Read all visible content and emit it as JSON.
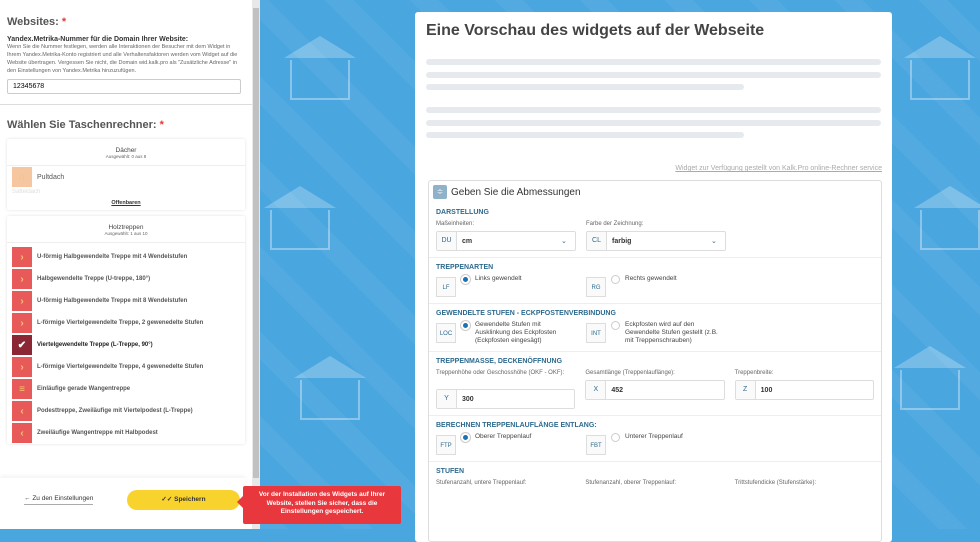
{
  "left": {
    "websites_title": "Websites:",
    "required_mark": "*",
    "yandex_label": "Yandex.Metrika-Nummer für die Domain Ihrer Website:",
    "yandex_desc": "Wenn Sie die Nummer festlegen, werden alle Interaktionen der Besucher mit dem Widget in Ihrem Yandex.Metrika-Konto registriert und alle Verhaltensfaktoren werden vom Widget auf die Website übertragen. Vergessen Sie nicht, die Domain wid.kalk.pro als \"Zusätzliche Adresse\" in den Einstellungen von Yandex.Metrika hinzuzufügen.",
    "yandex_value": "12345678",
    "calc_title": "Wählen Sie Taschenrechner:",
    "groups": [
      {
        "title": "Dächer",
        "selected": "Ausgewählt: 0 aus 8",
        "items": [
          {
            "label": "Pultdach"
          },
          {
            "label": "Satteldach"
          }
        ],
        "more": "Offenbaren"
      },
      {
        "title": "Holztreppen",
        "selected": "Ausgewählt: 1 aus 10",
        "items": [
          {
            "label": "U-förmig Halbgewendelte Treppe mit 4 Wendelstufen"
          },
          {
            "label": "Halbgewendelte Treppe (U-treppe, 180°)"
          },
          {
            "label": "U-förmig Halbgewendelte Treppe mit 8 Wendelstufen"
          },
          {
            "label": "L-förmige Viertelgewendelte Treppe, 2 gewenedelte Stufen"
          },
          {
            "label": "Viertelgewendelte Treppe (L-Treppe, 90°)"
          },
          {
            "label": "L-förmige Viertelgewendelte Treppe, 4 gewenedelte Stufen"
          },
          {
            "label": "Einläufige gerade Wangentreppe"
          },
          {
            "label": "Podesttreppe, Zweiläufige mit Viertelpodest (L-Treppe)"
          },
          {
            "label": "Zweiläufige Wangentreppe mit Halbpodest"
          }
        ]
      }
    ],
    "back": "Zu den Einstellungen",
    "save": "Speichern",
    "tooltip": "Vor der Installation des Widgets auf Ihrer Website, stellen Sie sicher, dass die Einstellungen gespeichert."
  },
  "preview": {
    "title": "Eine Vorschau des widgets auf der Webseite",
    "link": "Widget zur Verfügung gestellt von Kalk.Pro online-Rechner service",
    "box_title": "Geben Sie die Abmessungen",
    "darstellung": {
      "title": "DARSTELLUNG",
      "units_label": "Maßeinheiten:",
      "units_code": "DU",
      "units_value": "cm",
      "color_label": "Farbe der Zeichnung:",
      "color_code": "CL",
      "color_value": "farbig"
    },
    "treppenarten": {
      "title": "TREPPENARTEN",
      "a_code": "LF",
      "a_label": "Links gewendelt",
      "b_code": "RG",
      "b_label": "Rechts gewendelt"
    },
    "stufen_eck": {
      "title": "GEWENDELTE STUFEN - ECKPFOSTENVERBINDUNG",
      "a_code": "LOC",
      "a_label": "Gewendelte Stufen mit Ausklinkung des Eckpfosten (Eckpfosten eingesägt)",
      "b_code": "INT",
      "b_label": "Eckpfosten wird auf den Gewendelte Stufen gestellt (z.B. mit Treppenschrauben)"
    },
    "masse": {
      "title": "TREPPENMASSE, DECKENÖFFNUNG",
      "h_label": "Treppenhöhe oder Geschosshöhe (OKF - OKF):",
      "h_code": "Y",
      "h_value": "300",
      "l_label": "Gesamtlänge (Treppenlauflänge):",
      "l_code": "X",
      "l_value": "452",
      "w_label": "Treppenbreite:",
      "w_code": "Z",
      "w_value": "100"
    },
    "entlang": {
      "title": "BERECHNEN TREPPENLAUFLÄNGE ENTLANG:",
      "a_code": "FTP",
      "a_label": "Oberer Treppenlauf",
      "b_code": "FBT",
      "b_label": "Unterer Treppenlauf"
    },
    "stufen": {
      "title": "STUFEN",
      "a_label": "Stufenanzahl, untere Treppenlauf:",
      "b_label": "Stufenanzahl, oberer Treppenlauf:",
      "c_label": "Trittstufendicke (Stufenstärke):"
    }
  }
}
